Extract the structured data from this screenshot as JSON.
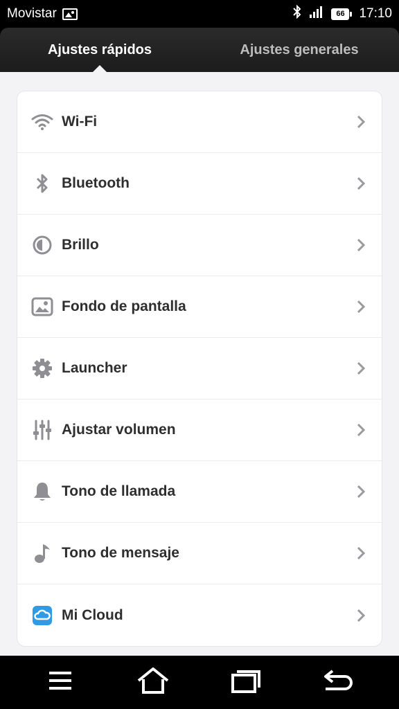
{
  "status_bar": {
    "carrier": "Movistar",
    "battery": "66",
    "time": "17:10",
    "icons": [
      "image-notification-icon",
      "bluetooth-icon",
      "signal-icon",
      "battery-icon"
    ]
  },
  "tabs": [
    {
      "label": "Ajustes rápidos",
      "active": true
    },
    {
      "label": "Ajustes generales",
      "active": false
    }
  ],
  "settings": [
    {
      "label": "Wi-Fi",
      "icon": "wifi-icon"
    },
    {
      "label": "Bluetooth",
      "icon": "bluetooth-icon"
    },
    {
      "label": "Brillo",
      "icon": "brightness-icon"
    },
    {
      "label": "Fondo de pantalla",
      "icon": "wallpaper-icon"
    },
    {
      "label": "Launcher",
      "icon": "gear-icon"
    },
    {
      "label": "Ajustar volumen",
      "icon": "sliders-icon"
    },
    {
      "label": "Tono de llamada",
      "icon": "bell-icon"
    },
    {
      "label": "Tono de mensaje",
      "icon": "music-note-icon"
    },
    {
      "label": "Mi Cloud",
      "icon": "cloud-icon"
    }
  ],
  "nav_bar": [
    "menu-icon",
    "home-icon",
    "recents-icon",
    "back-icon"
  ],
  "colors": {
    "accent_cloud": "#2f9be6",
    "icon_gray": "#8e8e93",
    "chevron": "#9a9a9e"
  }
}
